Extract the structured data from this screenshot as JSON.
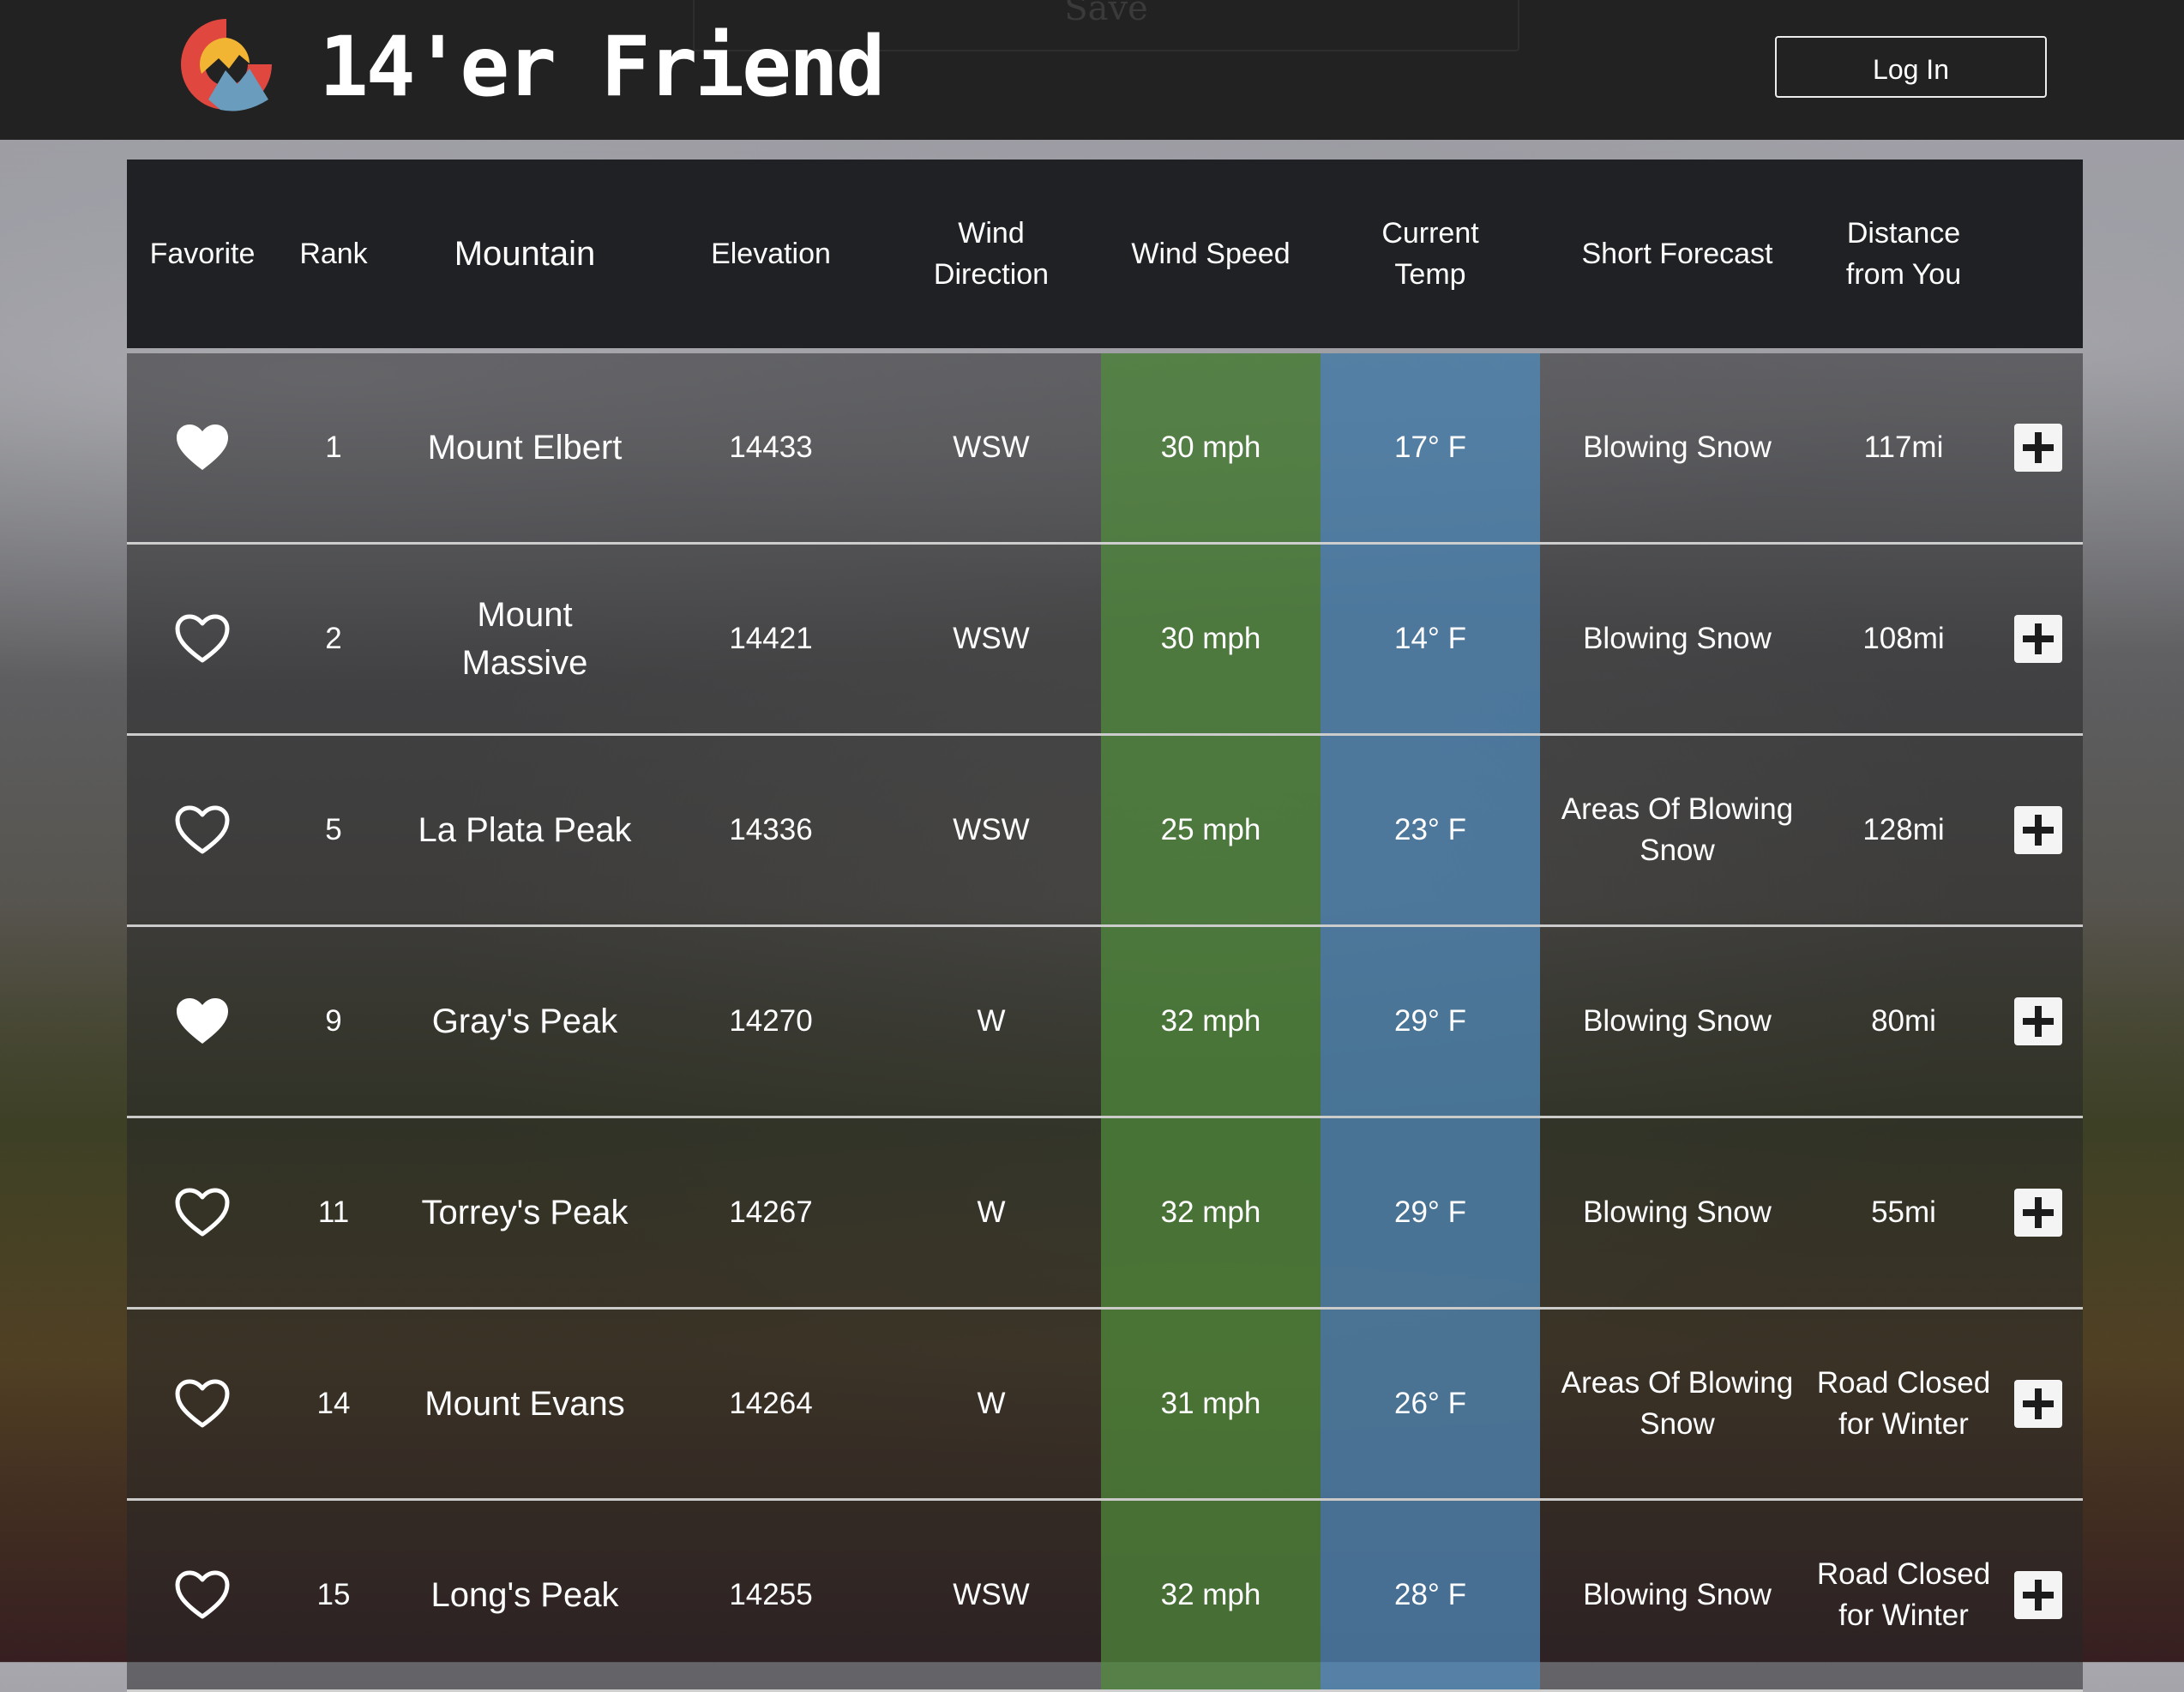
{
  "header": {
    "ghost_button_label": "Save",
    "brand": "14'er Friend",
    "login_label": "Log In",
    "logo_colors": [
      "#e0473f",
      "#f1b433",
      "#6a9dbd"
    ]
  },
  "table": {
    "headers": {
      "favorite": "Favorite",
      "rank": "Rank",
      "mountain": "Mountain",
      "elevation": "Elevation",
      "wind_direction": "Wind Direction",
      "wind_speed": "Wind Speed",
      "current_temp": "Current Temp",
      "short_forecast": "Short Forecast",
      "distance": "Distance from You"
    },
    "colors": {
      "wind_speed_col": "#4f8a3c",
      "temp_col": "#5a8fb8"
    },
    "rows": [
      {
        "favorite": true,
        "rank": "1",
        "mountain": "Mount Elbert",
        "elevation": "14433",
        "wind_direction": "WSW",
        "wind_speed": "30 mph",
        "temp": "17° F",
        "forecast": "Blowing Snow",
        "distance": "117mi"
      },
      {
        "favorite": false,
        "rank": "2",
        "mountain": "Mount Massive",
        "elevation": "14421",
        "wind_direction": "WSW",
        "wind_speed": "30 mph",
        "temp": "14° F",
        "forecast": "Blowing Snow",
        "distance": "108mi"
      },
      {
        "favorite": false,
        "rank": "5",
        "mountain": "La Plata Peak",
        "elevation": "14336",
        "wind_direction": "WSW",
        "wind_speed": "25 mph",
        "temp": "23° F",
        "forecast": "Areas Of Blowing Snow",
        "distance": "128mi"
      },
      {
        "favorite": true,
        "rank": "9",
        "mountain": "Gray's Peak",
        "elevation": "14270",
        "wind_direction": "W",
        "wind_speed": "32 mph",
        "temp": "29° F",
        "forecast": "Blowing Snow",
        "distance": "80mi"
      },
      {
        "favorite": false,
        "rank": "11",
        "mountain": "Torrey's Peak",
        "elevation": "14267",
        "wind_direction": "W",
        "wind_speed": "32 mph",
        "temp": "29° F",
        "forecast": "Blowing Snow",
        "distance": "55mi"
      },
      {
        "favorite": false,
        "rank": "14",
        "mountain": "Mount Evans",
        "elevation": "14264",
        "wind_direction": "W",
        "wind_speed": "31 mph",
        "temp": "26° F",
        "forecast": "Areas Of Blowing Snow",
        "distance": "Road Closed for Winter"
      },
      {
        "favorite": false,
        "rank": "15",
        "mountain": "Long's Peak",
        "elevation": "14255",
        "wind_direction": "WSW",
        "wind_speed": "32 mph",
        "temp": "28° F",
        "forecast": "Blowing Snow",
        "distance": "Road Closed for Winter"
      }
    ]
  }
}
